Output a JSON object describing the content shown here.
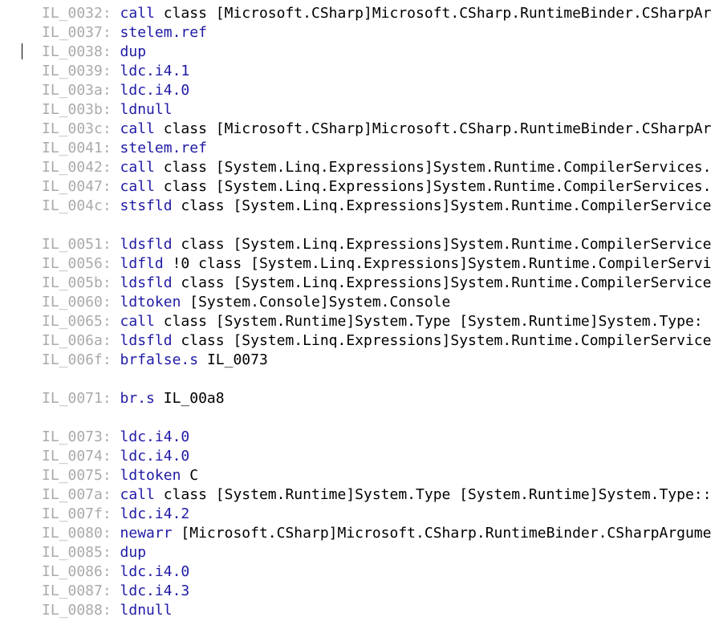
{
  "colors": {
    "label": "#aaaaaa",
    "opcode": "#1f1aa5",
    "operand": "#000000",
    "background": "#ffffff"
  },
  "lines": [
    {
      "label": "IL_0032:",
      "opcode": "call",
      "operand": "class [Microsoft.CSharp]Microsoft.CSharp.RuntimeBinder.CSharpAr"
    },
    {
      "label": "IL_0037:",
      "opcode": "stelem.ref",
      "operand": ""
    },
    {
      "label": "IL_0038:",
      "opcode": "dup",
      "operand": ""
    },
    {
      "label": "IL_0039:",
      "opcode": "ldc.i4.1",
      "operand": ""
    },
    {
      "label": "IL_003a:",
      "opcode": "ldc.i4.0",
      "operand": ""
    },
    {
      "label": "IL_003b:",
      "opcode": "ldnull",
      "operand": ""
    },
    {
      "label": "IL_003c:",
      "opcode": "call",
      "operand": "class [Microsoft.CSharp]Microsoft.CSharp.RuntimeBinder.CSharpAr"
    },
    {
      "label": "IL_0041:",
      "opcode": "stelem.ref",
      "operand": ""
    },
    {
      "label": "IL_0042:",
      "opcode": "call",
      "operand": "class [System.Linq.Expressions]System.Runtime.CompilerServices."
    },
    {
      "label": "IL_0047:",
      "opcode": "call",
      "operand": "class [System.Linq.Expressions]System.Runtime.CompilerServices."
    },
    {
      "label": "IL_004c:",
      "opcode": "stsfld",
      "operand": "class [System.Linq.Expressions]System.Runtime.CompilerService"
    },
    {
      "label": "",
      "opcode": "",
      "operand": ""
    },
    {
      "label": "IL_0051:",
      "opcode": "ldsfld",
      "operand": "class [System.Linq.Expressions]System.Runtime.CompilerService"
    },
    {
      "label": "IL_0056:",
      "opcode": "ldfld",
      "operand": "!0 class [System.Linq.Expressions]System.Runtime.CompilerServi"
    },
    {
      "label": "IL_005b:",
      "opcode": "ldsfld",
      "operand": "class [System.Linq.Expressions]System.Runtime.CompilerService"
    },
    {
      "label": "IL_0060:",
      "opcode": "ldtoken",
      "operand": "[System.Console]System.Console"
    },
    {
      "label": "IL_0065:",
      "opcode": "call",
      "operand": "class [System.Runtime]System.Type [System.Runtime]System.Type:"
    },
    {
      "label": "IL_006a:",
      "opcode": "ldsfld",
      "operand": "class [System.Linq.Expressions]System.Runtime.CompilerService"
    },
    {
      "label": "IL_006f:",
      "opcode": "brfalse.s",
      "operand": "IL_0073"
    },
    {
      "label": "",
      "opcode": "",
      "operand": ""
    },
    {
      "label": "IL_0071:",
      "opcode": "br.s",
      "operand": "IL_00a8"
    },
    {
      "label": "",
      "opcode": "",
      "operand": ""
    },
    {
      "label": "IL_0073:",
      "opcode": "ldc.i4.0",
      "operand": ""
    },
    {
      "label": "IL_0074:",
      "opcode": "ldc.i4.0",
      "operand": ""
    },
    {
      "label": "IL_0075:",
      "opcode": "ldtoken",
      "operand": "C"
    },
    {
      "label": "IL_007a:",
      "opcode": "call",
      "operand": "class [System.Runtime]System.Type [System.Runtime]System.Type::"
    },
    {
      "label": "IL_007f:",
      "opcode": "ldc.i4.2",
      "operand": ""
    },
    {
      "label": "IL_0080:",
      "opcode": "newarr",
      "operand": "[Microsoft.CSharp]Microsoft.CSharp.RuntimeBinder.CSharpArgume"
    },
    {
      "label": "IL_0085:",
      "opcode": "dup",
      "operand": ""
    },
    {
      "label": "IL_0086:",
      "opcode": "ldc.i4.0",
      "operand": ""
    },
    {
      "label": "IL_0087:",
      "opcode": "ldc.i4.3",
      "operand": ""
    },
    {
      "label": "IL_0088:",
      "opcode": "ldnull",
      "operand": ""
    }
  ]
}
